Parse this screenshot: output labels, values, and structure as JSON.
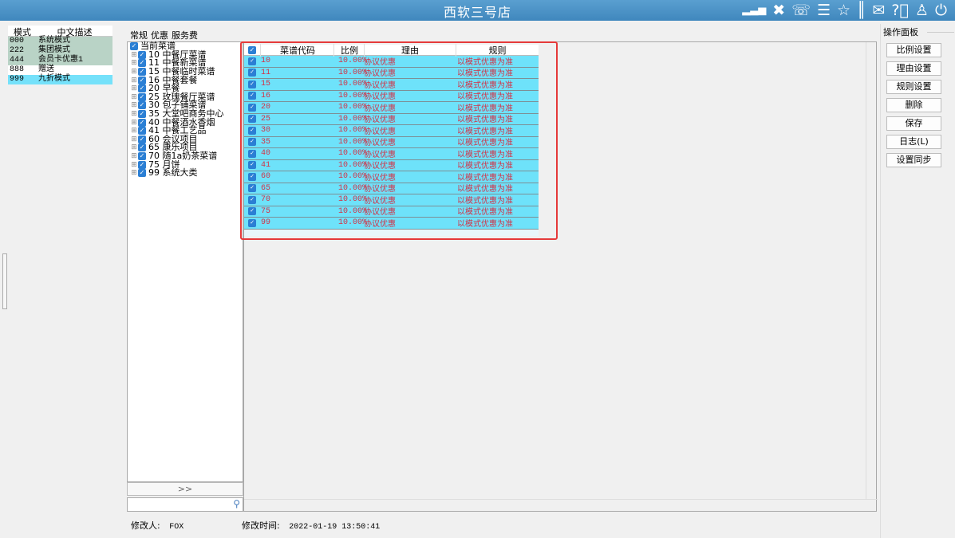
{
  "app": {
    "title": "西软三号店"
  },
  "titlebar_icons": [
    "signal-icon",
    "tools-icon",
    "phone-icon",
    "menu-icon",
    "star-icon",
    "columns-icon",
    "mail-icon",
    "help-icon",
    "user-icon",
    "power-icon"
  ],
  "modes": {
    "headers": [
      "模式",
      "中文描述"
    ],
    "rows": [
      {
        "code": "000",
        "desc": "系统模式"
      },
      {
        "code": "222",
        "desc": "集团模式"
      },
      {
        "code": "444",
        "desc": "会员卡优惠1"
      },
      {
        "code": "888",
        "desc": "赠送"
      },
      {
        "code": "999",
        "desc": "九折模式"
      }
    ]
  },
  "tabs": [
    {
      "label": "常规"
    },
    {
      "label": "优惠"
    },
    {
      "label": "服务费"
    }
  ],
  "tree": {
    "root": "当前菜谱",
    "items": [
      "10 中餐厅菜谱",
      "11 中餐新菜谱",
      "15 中餐临时菜谱",
      "16 中餐套餐",
      "20 早餐",
      "25 玫瑰餐厅菜谱",
      "30 包子铺菜谱",
      "35 大堂吧商务中心",
      "40 中餐酒水香烟",
      "41 中餐工艺品",
      "60 会议项目",
      "65 康乐项目",
      "70 随1a奶茶菜谱",
      "75 月饼",
      "99 系统大类"
    ],
    "more_label": ">>"
  },
  "grid": {
    "headers": [
      "菜谱代码",
      "比例",
      "理由",
      "规则"
    ],
    "rows": [
      {
        "code": "10",
        "ratio": "10.00%",
        "reason": "协议优惠",
        "rule": "以模式优惠为准"
      },
      {
        "code": "11",
        "ratio": "10.00%",
        "reason": "协议优惠",
        "rule": "以模式优惠为准"
      },
      {
        "code": "15",
        "ratio": "10.00%",
        "reason": "协议优惠",
        "rule": "以模式优惠为准"
      },
      {
        "code": "16",
        "ratio": "10.00%",
        "reason": "协议优惠",
        "rule": "以模式优惠为准"
      },
      {
        "code": "20",
        "ratio": "10.00%",
        "reason": "协议优惠",
        "rule": "以模式优惠为准"
      },
      {
        "code": "25",
        "ratio": "10.00%",
        "reason": "协议优惠",
        "rule": "以模式优惠为准"
      },
      {
        "code": "30",
        "ratio": "10.00%",
        "reason": "协议优惠",
        "rule": "以模式优惠为准"
      },
      {
        "code": "35",
        "ratio": "10.00%",
        "reason": "协议优惠",
        "rule": "以模式优惠为准"
      },
      {
        "code": "40",
        "ratio": "10.00%",
        "reason": "协议优惠",
        "rule": "以模式优惠为准"
      },
      {
        "code": "41",
        "ratio": "10.00%",
        "reason": "协议优惠",
        "rule": "以模式优惠为准"
      },
      {
        "code": "60",
        "ratio": "10.00%",
        "reason": "协议优惠",
        "rule": "以模式优惠为准"
      },
      {
        "code": "65",
        "ratio": "10.00%",
        "reason": "协议优惠",
        "rule": "以模式优惠为准"
      },
      {
        "code": "70",
        "ratio": "10.00%",
        "reason": "协议优惠",
        "rule": "以模式优惠为准"
      },
      {
        "code": "75",
        "ratio": "10.00%",
        "reason": "协议优惠",
        "rule": "以模式优惠为准"
      },
      {
        "code": "99",
        "ratio": "10.00%",
        "reason": "协议优惠",
        "rule": "以模式优惠为准"
      }
    ]
  },
  "ops": {
    "title": "操作面板",
    "buttons": [
      "比例设置",
      "理由设置",
      "规则设置",
      "删除",
      "保存",
      "日志(L)",
      "设置同步"
    ]
  },
  "footer": {
    "modifier_label": "修改人:",
    "modifier_value": "FOX",
    "time_label": "修改时间:",
    "time_value": "2022-01-19 13:50:41"
  },
  "colors": {
    "titlebar": "#4a92c8",
    "row_selected": "#6ee2fa",
    "row_text": "#d23246",
    "highlight": "#e53a3a"
  }
}
